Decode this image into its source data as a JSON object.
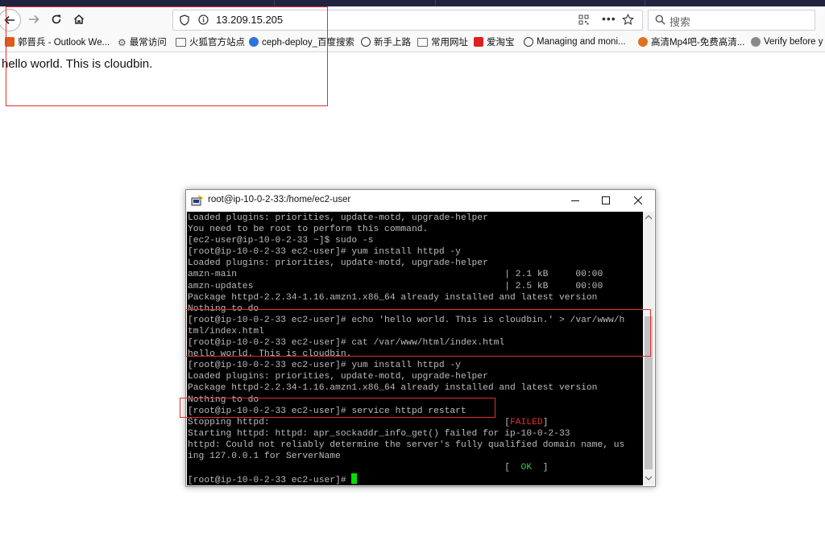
{
  "browser": {
    "url": "13.209.15.205",
    "search_placeholder": "搜索",
    "bookmarks": [
      {
        "label": "郭晋兵 - Outlook We...",
        "icon": "outlook-icon",
        "color": "#e05a1b"
      },
      {
        "label": "最常访问",
        "icon": "gear-icon",
        "color": "#555555"
      },
      {
        "label": "火狐官方站点",
        "icon": "folder-icon",
        "color": "#555555"
      },
      {
        "label": "ceph-deploy_百度搜索",
        "icon": "baidu-paw-icon",
        "color": "#2f6fe0"
      },
      {
        "label": "新手上路",
        "icon": "globe-icon",
        "color": "#333333"
      },
      {
        "label": "常用网址",
        "icon": "folder-icon",
        "color": "#555555"
      },
      {
        "label": "爱淘宝",
        "icon": "taobao-icon",
        "color": "#e02020"
      },
      {
        "label": "Managing and moni...",
        "icon": "globe-icon",
        "color": "#333333"
      },
      {
        "label": "高清Mp4吧-免费高清...",
        "icon": "play-icon",
        "color": "#e07020"
      },
      {
        "label": "Verify before y",
        "icon": "bug-icon",
        "color": "#555555"
      }
    ]
  },
  "page": {
    "body_text": "hello world. This is cloudbin."
  },
  "putty": {
    "title": "root@ip-10-0-2-33:/home/ec2-user",
    "lines": [
      "Loaded plugins: priorities, update-motd, upgrade-helper",
      "You need to be root to perform this command.",
      "[ec2-user@ip-10-0-2-33 ~]$ sudo -s",
      "[root@ip-10-0-2-33 ec2-user]# yum install httpd -y",
      "Loaded plugins: priorities, update-motd, upgrade-helper",
      "amzn-main                                                 | 2.1 kB     00:00",
      "amzn-updates                                              | 2.5 kB     00:00",
      "Package httpd-2.2.34-1.16.amzn1.x86_64 already installed and latest version",
      "Nothing to do",
      "[root@ip-10-0-2-33 ec2-user]# echo 'hello world. This is cloudbin.' > /var/www/h",
      "tml/index.html",
      "[root@ip-10-0-2-33 ec2-user]# cat /var/www/html/index.html",
      "hello world. This is cloudbin.",
      "[root@ip-10-0-2-33 ec2-user]# yum install httpd -y",
      "Loaded plugins: priorities, update-motd, upgrade-helper",
      "Package httpd-2.2.34-1.16.amzn1.x86_64 already installed and latest version",
      "Nothing to do",
      "[root@ip-10-0-2-33 ec2-user]# service httpd restart"
    ],
    "stopping_label": "Stopping httpd:                                           [",
    "failed_text": "FAILED",
    "stopping_end": "]",
    "after_lines": [
      "Starting httpd: httpd: apr_sockaddr_info_get() failed for ip-10-0-2-33",
      "httpd: Could not reliably determine the server's fully qualified domain name, us",
      "ing 127.0.0.1 for ServerName"
    ],
    "ok_prefix": "                                                          [  ",
    "ok_text": "OK",
    "ok_suffix": "  ]",
    "prompt": "[root@ip-10-0-2-33 ec2-user]# "
  },
  "colors": {
    "annotation_red": "#e03030",
    "terminal_bg": "#000000",
    "terminal_fg": "#bbbbbb",
    "cursor": "#00e000"
  }
}
